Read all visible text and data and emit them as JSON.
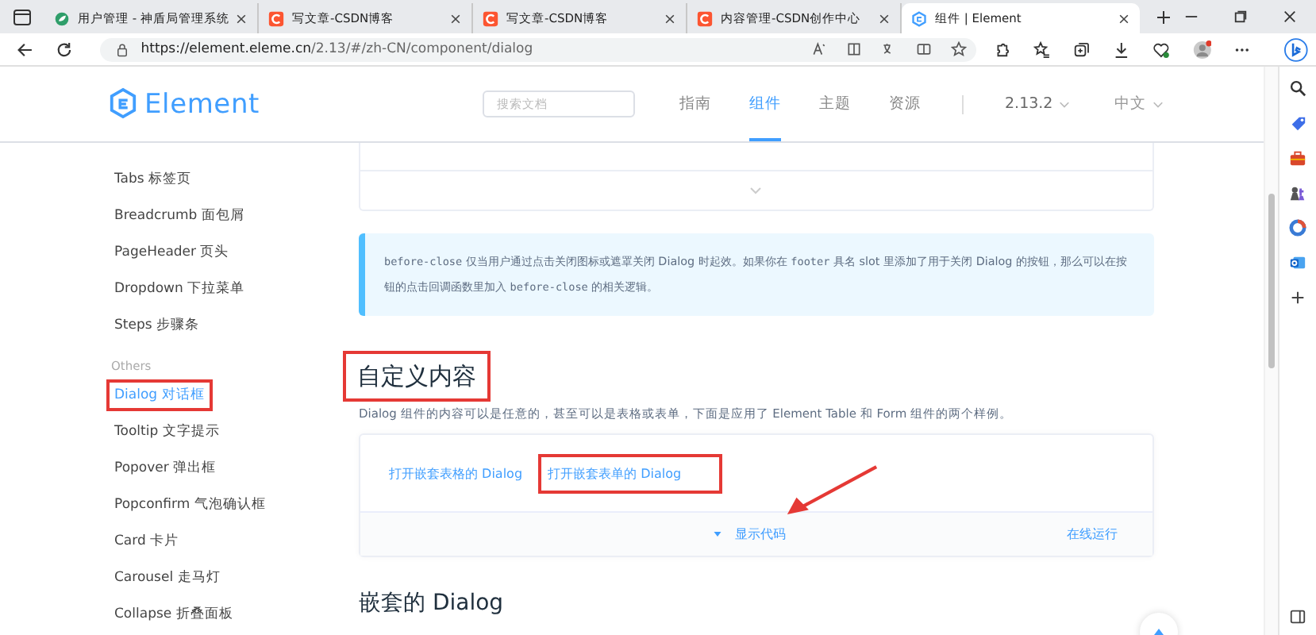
{
  "browser_tabs": [
    {
      "title": "用户管理 - 神盾局管理系统",
      "kind": "leaf",
      "selected": false
    },
    {
      "title": "写文章-CSDN博客",
      "kind": "csdn",
      "selected": false
    },
    {
      "title": "写文章-CSDN博客",
      "kind": "csdn",
      "selected": false
    },
    {
      "title": "内容管理-CSDN创作中心",
      "kind": "csdn",
      "selected": false
    },
    {
      "title": "组件 | Element",
      "kind": "element",
      "selected": true
    }
  ],
  "address_bar": {
    "host": "https://element.eleme.cn",
    "path": "/2.13/#/zh-CN/component/dialog"
  },
  "site_header": {
    "logo": "Element",
    "search": {
      "placeholder": "搜索文档"
    },
    "nav": [
      {
        "label": "指南",
        "selected": false
      },
      {
        "label": "组件",
        "selected": true
      },
      {
        "label": "主题",
        "selected": false
      },
      {
        "label": "资源",
        "selected": false
      }
    ],
    "version": "2.13.2",
    "language": "中文"
  },
  "sidebar": {
    "items": [
      {
        "kind": "item",
        "label": "Tabs 标签页",
        "selected": false,
        "highlighted": false
      },
      {
        "kind": "item",
        "label": "Breadcrumb 面包屑",
        "selected": false,
        "highlighted": false
      },
      {
        "kind": "item",
        "label": "PageHeader 页头",
        "selected": false,
        "highlighted": false
      },
      {
        "kind": "item",
        "label": "Dropdown 下拉菜单",
        "selected": false,
        "highlighted": false
      },
      {
        "kind": "item",
        "label": "Steps 步骤条",
        "selected": false,
        "highlighted": false
      },
      {
        "kind": "group",
        "label": "Others"
      },
      {
        "kind": "item",
        "label": "Dialog 对话框",
        "selected": true,
        "highlighted": true
      },
      {
        "kind": "item",
        "label": "Tooltip 文字提示",
        "selected": false,
        "highlighted": false
      },
      {
        "kind": "item",
        "label": "Popover 弹出框",
        "selected": false,
        "highlighted": false
      },
      {
        "kind": "item",
        "label": "Popconfirm 气泡确认框",
        "selected": false,
        "highlighted": false
      },
      {
        "kind": "item",
        "label": "Card 卡片",
        "selected": false,
        "highlighted": false
      },
      {
        "kind": "item",
        "label": "Carousel 走马灯",
        "selected": false,
        "highlighted": false
      },
      {
        "kind": "item",
        "label": "Collapse 折叠面板",
        "selected": false,
        "highlighted": false
      }
    ]
  },
  "content": {
    "tip": [
      {
        "kind": "code",
        "text": "before-close"
      },
      {
        "kind": "text",
        "text": " 仅当用户通过点击关闭图标或遮罩关闭 Dialog 时起效。如果你在 "
      },
      {
        "kind": "code",
        "text": "footer"
      },
      {
        "kind": "text",
        "text": " 具名 slot 里添加了用于关闭 Dialog 的按钮，那么可以在按钮的点击回调函数里加入 "
      },
      {
        "kind": "code",
        "text": "before-close"
      },
      {
        "kind": "text",
        "text": " 的相关逻辑。"
      }
    ],
    "section": {
      "title": "自定义内容",
      "highlighted": true,
      "description": "Dialog 组件的内容可以是任意的，甚至可以是表格或表单，下面是应用了 Element Table 和 Form 组件的两个样例。",
      "demo_buttons": [
        {
          "label": "打开嵌套表格的 Dialog",
          "highlighted": false
        },
        {
          "label": "打开嵌套表单的 Dialog",
          "highlighted": true
        }
      ],
      "show_code": "显示代码",
      "run_online": "在线运行"
    },
    "next_title": "嵌套的 Dialog"
  }
}
